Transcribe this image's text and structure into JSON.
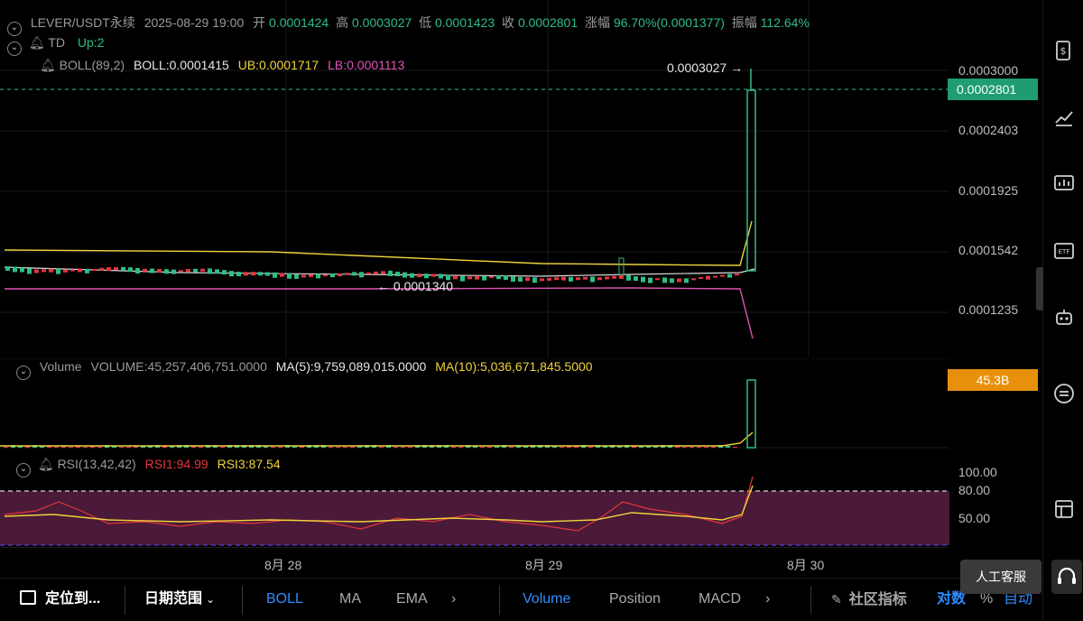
{
  "header": {
    "symbol": "LEVER/USDT永续",
    "datetime": "2025-08-29 19:00",
    "open_label": "开",
    "open": "0.0001424",
    "high_label": "高",
    "high": "0.0003027",
    "low_label": "低",
    "low": "0.0001423",
    "close_label": "收",
    "close": "0.0002801",
    "change_label": "涨幅",
    "change": "96.70%(0.0001377)",
    "amplitude_label": "振幅",
    "amplitude": "112.64%"
  },
  "td": {
    "name": "TD",
    "up": "Up:2"
  },
  "boll": {
    "name": "BOLL(89,2)",
    "mid": "BOLL:0.0001415",
    "ub": "UB:0.0001717",
    "lb": "LB:0.0001113"
  },
  "annotations": {
    "high_marker": "0.0003027 →",
    "low_marker": "← 0.0001340"
  },
  "price_axis": {
    "ticks": [
      "0.0003000",
      "0.0002403",
      "0.0001925",
      "0.0001542",
      "0.0001235"
    ],
    "current_price": "0.0002801"
  },
  "volume": {
    "name": "Volume",
    "value": "VOLUME:45,257,406,751.0000",
    "ma5": "MA(5):9,759,089,015.0000",
    "ma10": "MA(10):5,036,671,845.5000",
    "tag": "45.3B"
  },
  "rsi": {
    "name": "RSI(13,42,42)",
    "rsi1": "RSI1:94.99",
    "rsi3": "RSI3:87.54",
    "ticks": [
      "100.00",
      "80.00",
      "50.00"
    ]
  },
  "x_axis": {
    "labels": [
      "8月 28",
      "8月 29",
      "8月 30"
    ]
  },
  "bottom_bar": {
    "locate": "定位到...",
    "date_range": "日期范围",
    "indicators_main": [
      "BOLL",
      "MA",
      "EMA"
    ],
    "indicators_sub": [
      "Volume",
      "Position",
      "MACD"
    ],
    "community": "社区指标",
    "log": "对数",
    "percent": "%",
    "auto": "自动"
  },
  "tooltip": "人工客服",
  "colors": {
    "up": "#2ebd85",
    "down": "#e5353e",
    "boll_ub": "#f0d23c",
    "boll_lb": "#e052b5",
    "accent": "#2f8cff",
    "volume_tag": "#e8900c",
    "price_tag": "#1f9d70"
  }
}
